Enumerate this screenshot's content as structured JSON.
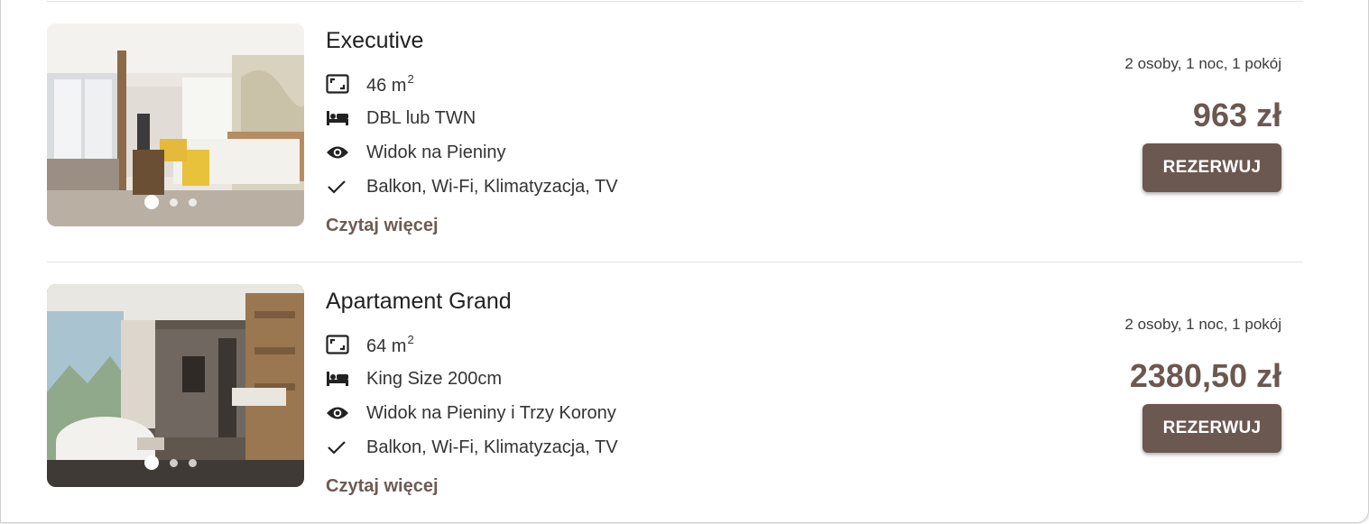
{
  "rooms": [
    {
      "name": "Executive",
      "area_value": "46 m",
      "area_sup": "2",
      "bed": "DBL lub TWN",
      "view": "Widok na Pieniny",
      "amenities": "Balkon, Wi-Fi, Klimatyzacja, TV",
      "read_more": "Czytaj więcej",
      "occupancy": "2 osoby, 1 noc, 1 pokój",
      "price": "963 zł",
      "book_label": "REZERWUJ",
      "slides_total": 3,
      "active_slide": 1
    },
    {
      "name": "Apartament Grand",
      "area_value": "64 m",
      "area_sup": "2",
      "bed": "King Size 200cm",
      "view": "Widok na Pieniny i Trzy Korony",
      "amenities": "Balkon, Wi-Fi, Klimatyzacja, TV",
      "read_more": "Czytaj więcej",
      "occupancy": "2 osoby, 1 noc, 1 pokój",
      "price": "2380,50 zł",
      "book_label": "REZERWUJ",
      "slides_total": 3,
      "active_slide": 1
    }
  ],
  "icons": {
    "area": "area-icon",
    "bed": "bed-icon",
    "view": "eye-icon",
    "amenities": "check-icon"
  },
  "colors": {
    "accent": "#6b5850",
    "text": "#212121",
    "divider": "#e3e3e3"
  }
}
